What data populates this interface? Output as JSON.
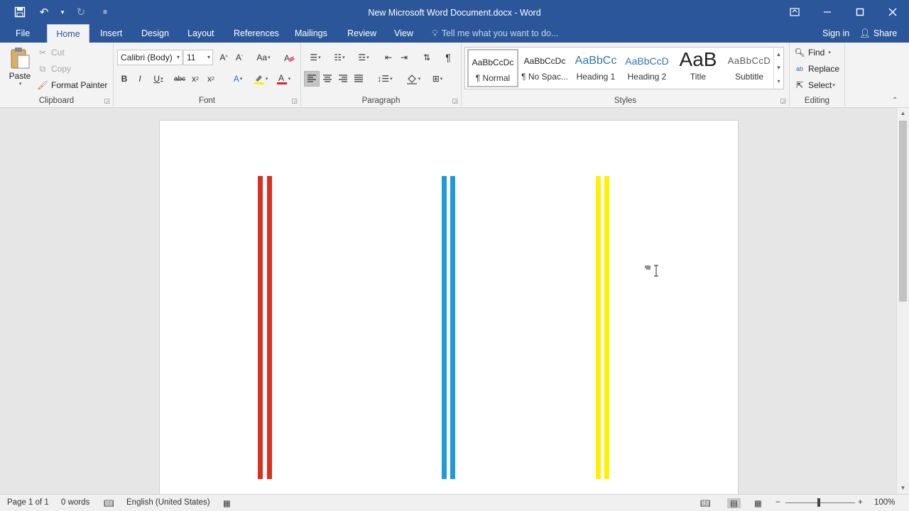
{
  "title_bar": {
    "document_title": "New Microsoft Word Document.docx - Word",
    "qat_icons": [
      "save-icon",
      "undo-icon",
      "redo-icon",
      "customize-icon"
    ],
    "window_controls": [
      "ribbon-display-icon",
      "minimize-icon",
      "maximize-icon",
      "close-icon"
    ]
  },
  "tabs": [
    {
      "label": "File"
    },
    {
      "label": "Home"
    },
    {
      "label": "Insert"
    },
    {
      "label": "Design"
    },
    {
      "label": "Layout"
    },
    {
      "label": "References"
    },
    {
      "label": "Mailings"
    },
    {
      "label": "Review"
    },
    {
      "label": "View"
    }
  ],
  "active_tab": "Home",
  "tell_me": "Tell me what you want to do...",
  "sign_in": "Sign in",
  "share": "Share",
  "ribbon": {
    "clipboard": {
      "label": "Clipboard",
      "paste": "Paste",
      "cut": "Cut",
      "copy": "Copy",
      "format_painter": "Format Painter"
    },
    "font": {
      "label": "Font",
      "font_name": "Calibri (Body)",
      "font_size": "11"
    },
    "paragraph": {
      "label": "Paragraph"
    },
    "styles": {
      "label": "Styles",
      "items": [
        {
          "preview": "AaBbCcDc",
          "name": "¶ Normal"
        },
        {
          "preview": "AaBbCcDc",
          "name": "¶ No Spac..."
        },
        {
          "preview": "AaBbCc",
          "name": "Heading 1"
        },
        {
          "preview": "AaBbCcD",
          "name": "Heading 2"
        },
        {
          "preview": "AaB",
          "name": "Title"
        },
        {
          "preview": "AaBbCcD",
          "name": "Subtitle"
        }
      ]
    },
    "editing": {
      "label": "Editing",
      "find": "Find",
      "replace": "Replace",
      "select": "Select"
    }
  },
  "document": {
    "stripe_colors": {
      "red": "#d9301f",
      "blue": "#1e9bd7",
      "yellow": "#fff200"
    }
  },
  "status_bar": {
    "page": "Page 1 of 1",
    "words": "0 words",
    "language": "English (United States)",
    "zoom": "100%"
  },
  "colors": {
    "accent": "#2b579a",
    "ribbon_bg": "#f3f3f3",
    "doc_bg": "#e6e6e6"
  }
}
